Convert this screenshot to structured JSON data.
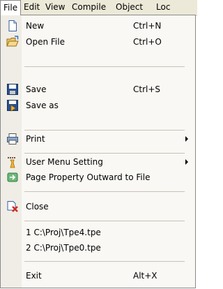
{
  "menubar": {
    "file": "File",
    "edit": "Edit",
    "view": "View",
    "compile": "Compile",
    "object": "Object",
    "loc": "Loc"
  },
  "file_menu": {
    "new": {
      "label": "New",
      "shortcut": "Ctrl+N",
      "icon": "new-file-icon"
    },
    "open": {
      "label": "Open File",
      "shortcut": "Ctrl+O",
      "icon": "open-folder-icon"
    },
    "save": {
      "label": "Save",
      "shortcut": "Ctrl+S",
      "icon": "floppy-disk-icon"
    },
    "save_as": {
      "label": "Save as",
      "icon": "save-as-icon"
    },
    "print": {
      "label": "Print",
      "icon": "printer-icon"
    },
    "user_menu": {
      "label": "User Menu Setting",
      "icon": "user-menu-icon"
    },
    "page_property": {
      "label": "Page Property Outward to File",
      "icon": "export-icon"
    },
    "close": {
      "label": "Close",
      "icon": "close-file-icon"
    },
    "recent1": {
      "label": "1 C:\\Proj\\Tpe4.tpe"
    },
    "recent2": {
      "label": "2 C:\\Proj\\Tpe0.tpe"
    },
    "exit": {
      "label": "Exit",
      "shortcut": "Alt+X"
    }
  },
  "colors": {
    "menubar_bg": "#ece9d8",
    "menu_bg": "#f9f8f4",
    "gutter_bg": "#efede5",
    "border": "#8a8a8a"
  }
}
